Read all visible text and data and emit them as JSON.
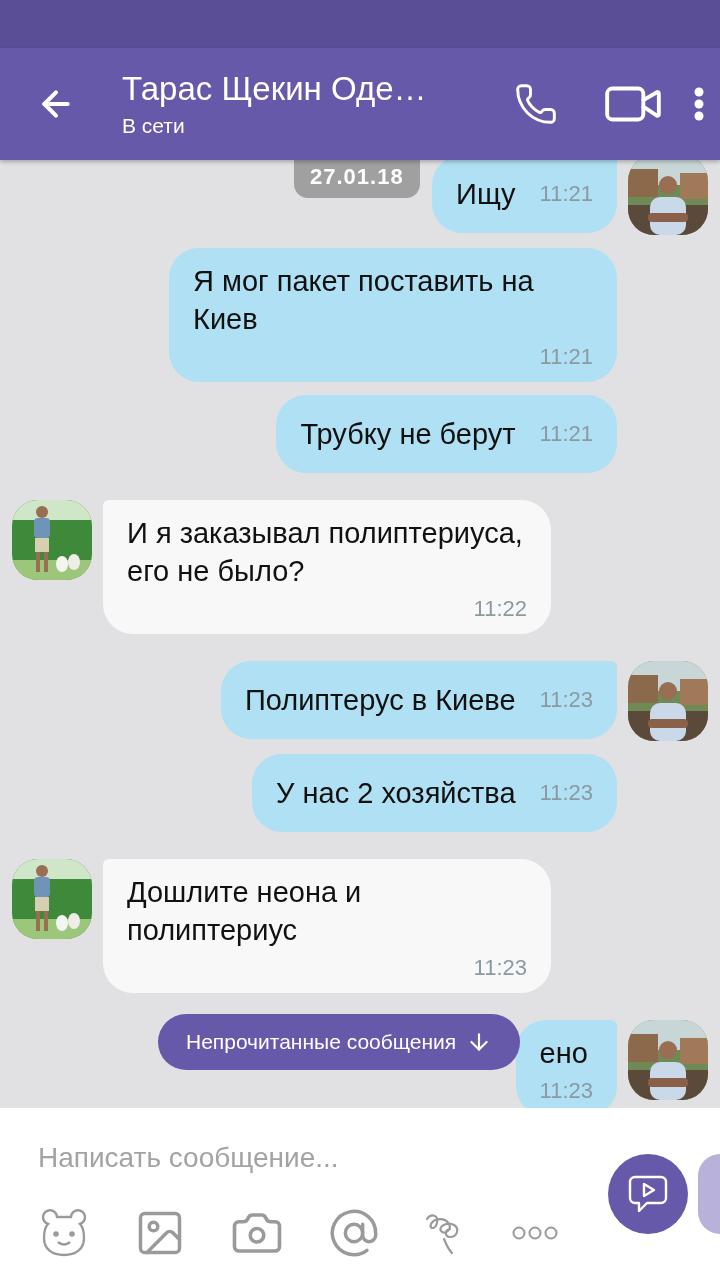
{
  "header": {
    "title": "Тарас Щекин Оде…",
    "status": "В сети"
  },
  "date_pill": "27.01.18",
  "messages": [
    {
      "kind": "outgoing",
      "avatar": true,
      "time_below": false,
      "text": "Ищу",
      "time": "11:21"
    },
    {
      "kind": "outgoing",
      "avatar": false,
      "time_below": true,
      "text": "Я мог пакет поставить на Киев",
      "time": "11:21"
    },
    {
      "kind": "outgoing",
      "avatar": false,
      "time_below": false,
      "text": "Трубку не берут",
      "time": "11:21"
    },
    {
      "kind": "incoming",
      "avatar": true,
      "time_below": true,
      "text": "И я заказывал полиптериуса, его не было?",
      "time": "11:22"
    },
    {
      "kind": "outgoing",
      "avatar": true,
      "time_below": false,
      "text": "Полиптерус в Киеве",
      "time": "11:23"
    },
    {
      "kind": "outgoing",
      "avatar": false,
      "time_below": false,
      "text": "У нас 2 хозяйства",
      "time": "11:23"
    },
    {
      "kind": "incoming",
      "avatar": true,
      "time_below": true,
      "text": "Дошлите неона и полиптериус",
      "time": "11:23"
    },
    {
      "kind": "outgoing",
      "avatar": true,
      "time_below": true,
      "text": "ено",
      "time": "11:23"
    }
  ],
  "unread_banner": "Непрочитанные сообщения",
  "composer": {
    "placeholder": "Написать сообщение..."
  }
}
